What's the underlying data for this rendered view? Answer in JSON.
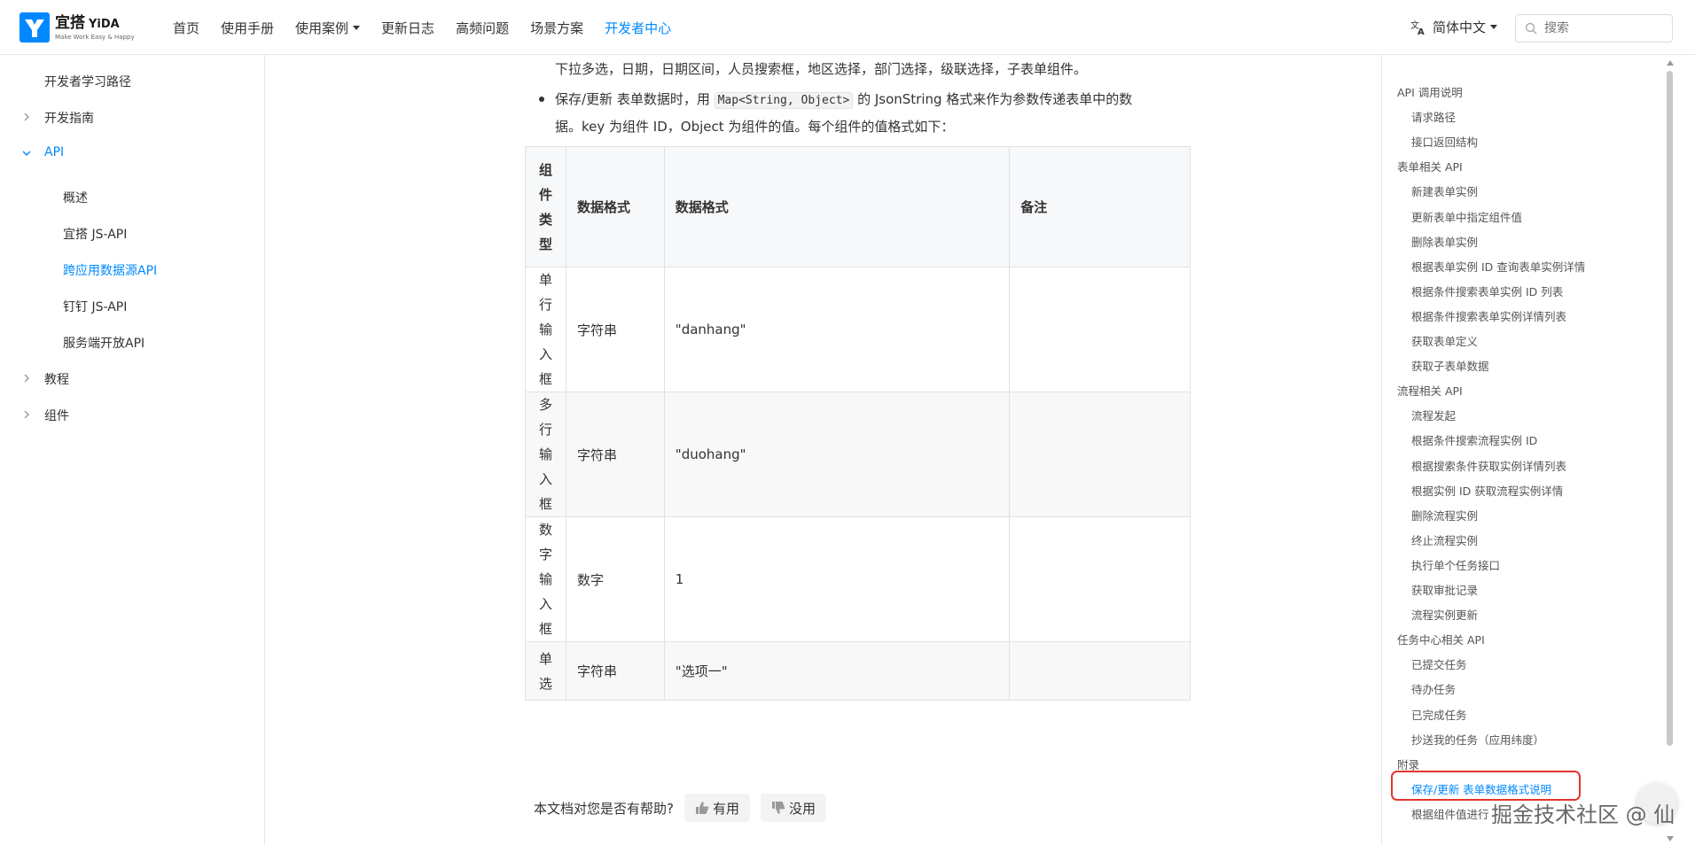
{
  "header": {
    "logo_name": "宜搭",
    "logo_name_en": "YiDA",
    "logo_tagline": "Make Work Easy & Happy",
    "nav": [
      {
        "label": "首页",
        "dropdown": false,
        "active": false
      },
      {
        "label": "使用手册",
        "dropdown": false,
        "active": false
      },
      {
        "label": "使用案例",
        "dropdown": true,
        "active": false
      },
      {
        "label": "更新日志",
        "dropdown": false,
        "active": false
      },
      {
        "label": "高频问题",
        "dropdown": false,
        "active": false
      },
      {
        "label": "场景方案",
        "dropdown": false,
        "active": false
      },
      {
        "label": "开发者中心",
        "dropdown": false,
        "active": true
      }
    ],
    "language": "简体中文",
    "search_placeholder": "搜索"
  },
  "sidebar": {
    "items": [
      {
        "label": "开发者学习路径",
        "level": 0,
        "expandable": false,
        "expanded": false,
        "active": false
      },
      {
        "label": "开发指南",
        "level": 0,
        "expandable": true,
        "expanded": false,
        "active": false
      },
      {
        "label": "API",
        "level": 0,
        "expandable": true,
        "expanded": true,
        "active": true
      },
      {
        "label": "概述",
        "level": 1,
        "expandable": false,
        "expanded": false,
        "active": false
      },
      {
        "label": "宜搭 JS-API",
        "level": 1,
        "expandable": false,
        "expanded": false,
        "active": false
      },
      {
        "label": "跨应用数据源API",
        "level": 1,
        "expandable": false,
        "expanded": false,
        "active": true
      },
      {
        "label": "钉钉 JS-API",
        "level": 1,
        "expandable": false,
        "expanded": false,
        "active": false
      },
      {
        "label": "服务端开放API",
        "level": 1,
        "expandable": false,
        "expanded": false,
        "active": false
      },
      {
        "label": "教程",
        "level": 0,
        "expandable": true,
        "expanded": false,
        "active": false
      },
      {
        "label": "组件",
        "level": 0,
        "expandable": true,
        "expanded": false,
        "active": false
      }
    ]
  },
  "content": {
    "line1": "下拉多选，日期，日期区间，人员搜索框，地区选择，部门选择，级联选择，子表单组件。",
    "bullet_a": "保存/更新 表单数据时，用 ",
    "bullet_code": "Map<String, Object>",
    "bullet_b": " 的 JsonString 格式来作为参数传递表单中的数",
    "bullet_line2": "据。key 为组件 ID，Object 为组件的值。每个组件的值格式如下：",
    "table": {
      "headers": [
        "组件类型",
        "数据格式",
        "数据格式",
        "备注"
      ],
      "rows": [
        [
          "单行输入框",
          "字符串",
          "\"danhang\"",
          ""
        ],
        [
          "多行输入框",
          "字符串",
          "\"duohang\"",
          ""
        ],
        [
          "数字输入框",
          "数字",
          "1",
          ""
        ],
        [
          "单选",
          "字符串",
          "\"选项一\"",
          ""
        ]
      ]
    },
    "feedback": {
      "question": "本文档对您是否有帮助?",
      "useful": "有用",
      "useless": "没用"
    }
  },
  "toc": {
    "items": [
      {
        "label": "API 调用说明",
        "level": 0
      },
      {
        "label": "请求路径",
        "level": 1
      },
      {
        "label": "接口返回结构",
        "level": 1
      },
      {
        "label": "表单相关 API",
        "level": 0
      },
      {
        "label": "新建表单实例",
        "level": 1
      },
      {
        "label": "更新表单中指定组件值",
        "level": 1
      },
      {
        "label": "删除表单实例",
        "level": 1
      },
      {
        "label": "根据表单实例 ID 查询表单实例详情",
        "level": 1
      },
      {
        "label": "根据条件搜索表单实例 ID 列表",
        "level": 1
      },
      {
        "label": "根据条件搜索表单实例详情列表",
        "level": 1
      },
      {
        "label": "获取表单定义",
        "level": 1
      },
      {
        "label": "获取子表单数据",
        "level": 1
      },
      {
        "label": "流程相关 API",
        "level": 0
      },
      {
        "label": "流程发起",
        "level": 1
      },
      {
        "label": "根据条件搜索流程实例 ID",
        "level": 1
      },
      {
        "label": "根据搜索条件获取实例详情列表",
        "level": 1
      },
      {
        "label": "根据实例 ID 获取流程实例详情",
        "level": 1
      },
      {
        "label": "删除流程实例",
        "level": 1
      },
      {
        "label": "终止流程实例",
        "level": 1
      },
      {
        "label": "执行单个任务接口",
        "level": 1
      },
      {
        "label": "获取审批记录",
        "level": 1
      },
      {
        "label": "流程实例更新",
        "level": 1
      },
      {
        "label": "任务中心相关 API",
        "level": 0
      },
      {
        "label": "已提交任务",
        "level": 1
      },
      {
        "label": "待办任务",
        "level": 1
      },
      {
        "label": "已完成任务",
        "level": 1
      },
      {
        "label": "抄送我的任务（应用纬度）",
        "level": 1
      },
      {
        "label": "附录",
        "level": 0
      },
      {
        "label": "保存/更新 表单数据格式说明",
        "level": 1,
        "current": true
      },
      {
        "label": "根据组件值进行",
        "level": 1
      }
    ]
  },
  "watermark": "掘金技术社区 @ 仙",
  "colors": {
    "accent": "#0089ff",
    "highlight": "#e4352c"
  }
}
